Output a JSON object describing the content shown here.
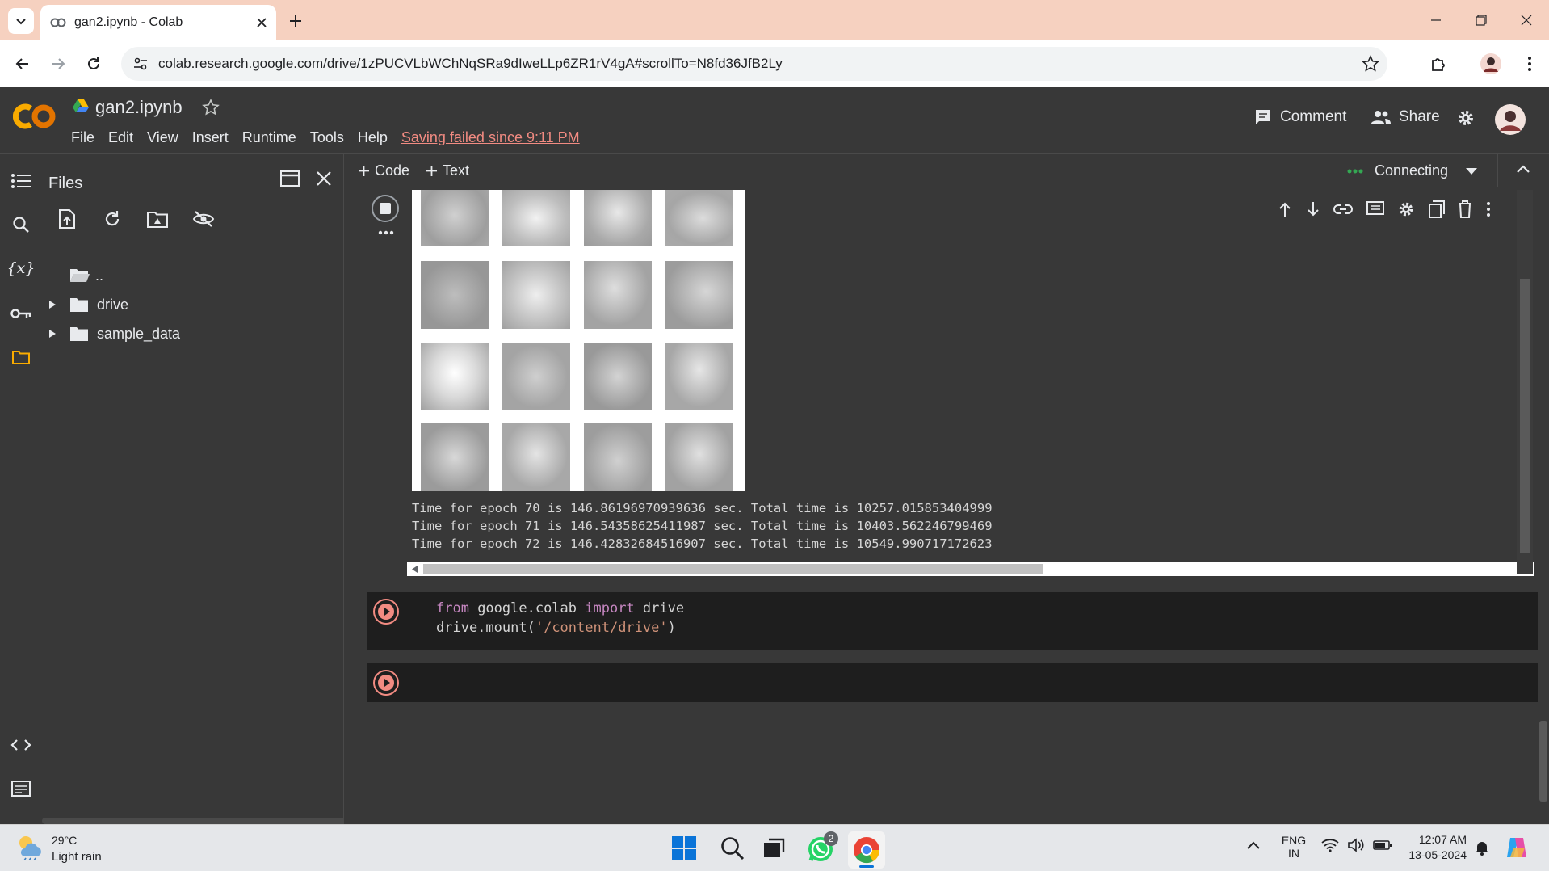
{
  "browser": {
    "tab_title": "gan2.ipynb - Colab",
    "url": "colab.research.google.com/drive/1zPUCVLbWChNqSRa9dIweLLp6ZR1rV4gA#scrollTo=N8fd36JfB2Ly"
  },
  "colab": {
    "logo": "CO",
    "filename": "gan2.ipynb",
    "menu": [
      "File",
      "Edit",
      "View",
      "Insert",
      "Runtime",
      "Tools",
      "Help"
    ],
    "save_status": "Saving failed since 9:11 PM",
    "comment_label": "Comment",
    "share_label": "Share",
    "add_code": "Code",
    "add_text": "Text",
    "runtime_status": "Connecting"
  },
  "files": {
    "title": "Files",
    "items": [
      "..",
      "drive",
      "sample_data"
    ]
  },
  "output": {
    "log_lines": [
      "Time for epoch 70 is 146.86196970939636 sec. Total time is 10257.015853404999",
      "Time for epoch 71 is 146.54358625411987 sec. Total time is 10403.562246799469",
      "Time for epoch 72 is 146.42832684516907 sec. Total time is 10549.990717172623"
    ]
  },
  "code": {
    "kw_from": "from",
    "module": " google.colab ",
    "kw_import": "import",
    "name": " drive",
    "line2_prefix": "drive.mount(",
    "line2_quote": "'",
    "line2_path": "/content/drive",
    "line2_suffix": ")"
  },
  "taskbar": {
    "temperature": "29°C",
    "weather": "Light rain",
    "lang": "ENG",
    "region": "IN",
    "time": "12:07 AM",
    "date": "13-05-2024",
    "whatsapp_badge": "2"
  }
}
